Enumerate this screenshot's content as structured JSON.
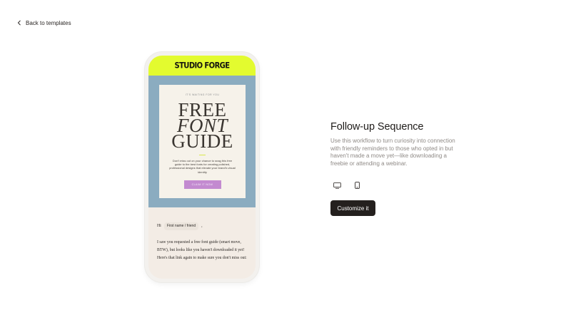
{
  "nav": {
    "back_label": "Back to templates"
  },
  "preview": {
    "brand": "STUDIO FORGE",
    "kicker": "IT'S WAITING FOR YOU",
    "headline_1": "FREE",
    "headline_2": "FONT",
    "headline_3": "GUIDE",
    "body": "Don't miss out on your chance to snag this free guide to the best fonts for creating polished, professional designs that elevate your brand's visual identity",
    "cta": "CLAIM IT NOW",
    "greeting": "Hi",
    "merge_tag": "First name / friend",
    "greeting_punct": ",",
    "paragraph": "I saw you requested a free font guide (smart move, BTW), but looks like you haven't downloaded it yet! Here's that link again to make sure you don't miss out:"
  },
  "template": {
    "title": "Follow-up Sequence",
    "description": "Use this workflow to turn curiosity into connection with friendly reminders to those who opted in but haven't made a move yet—like downloading a freebie or attending a webinar.",
    "cta_label": "Customize it"
  },
  "devices": [
    {
      "icon": "desktop-icon",
      "selected": false
    },
    {
      "icon": "mobile-icon",
      "selected": true
    }
  ],
  "colors": {
    "brand_bar": "#e3fb2f",
    "hero_bg": "#8bacc0",
    "claim_button": "#c38ad0",
    "primary_button": "#24201e"
  }
}
